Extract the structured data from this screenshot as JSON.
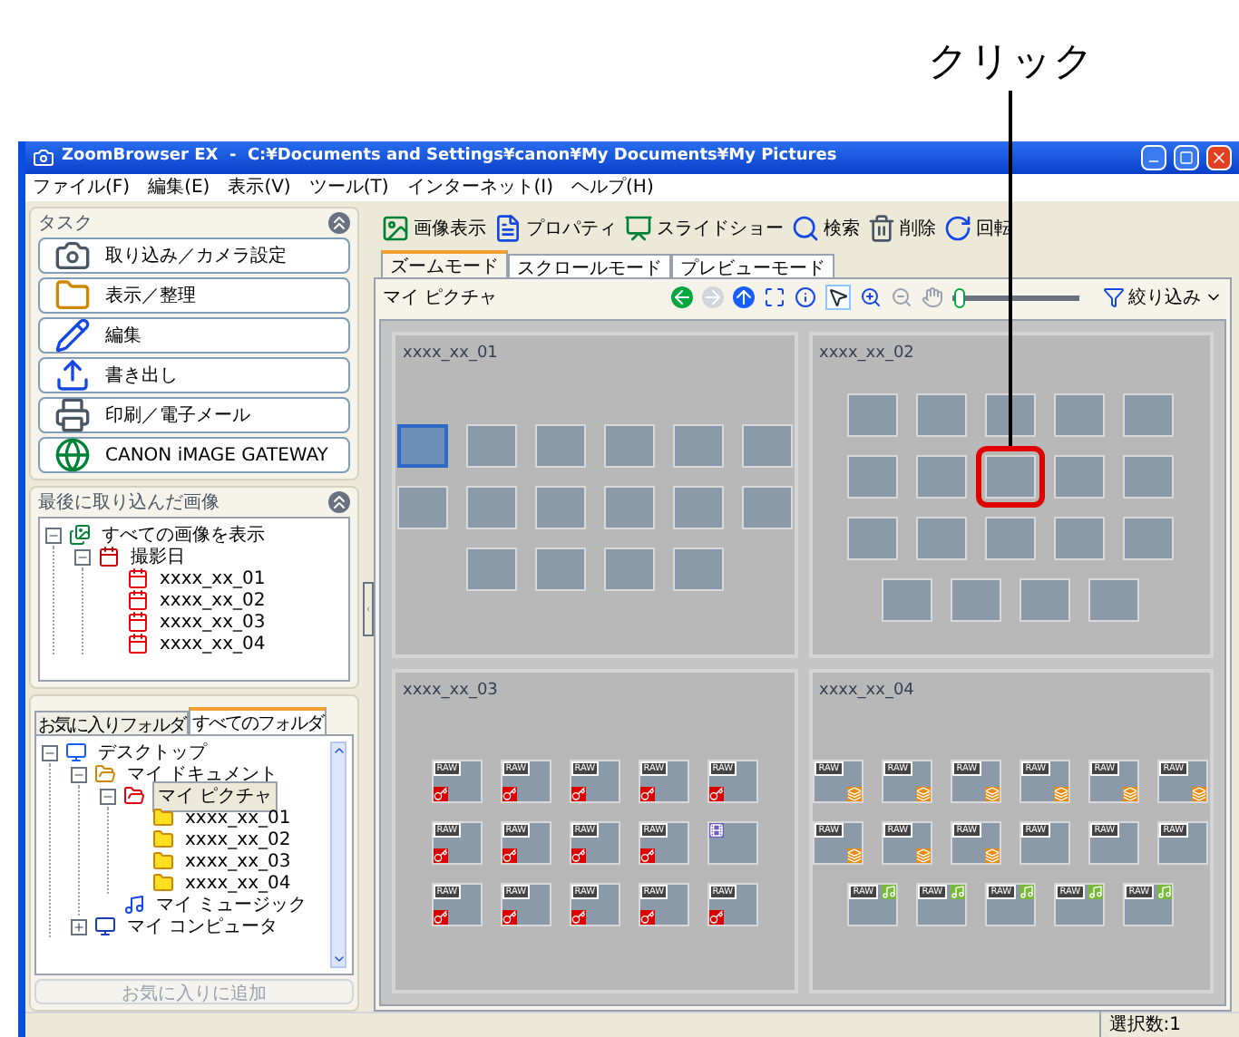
{
  "callout": {
    "label": "クリック"
  },
  "window": {
    "title": "ZoomBrowser EX  -  C:¥Documents and Settings¥canon¥My Documents¥My Pictures"
  },
  "menu": [
    "ファイル(F)",
    "編集(E)",
    "表示(V)",
    "ツール(T)",
    "インターネット(I)",
    "ヘルプ(H)"
  ],
  "tasks": {
    "title": "タスク",
    "items": [
      {
        "label": "取り込み／カメラ設定",
        "kind": "camera"
      },
      {
        "label": "表示／整理",
        "kind": "folder"
      },
      {
        "label": "編集",
        "kind": "edit"
      },
      {
        "label": "書き出し",
        "kind": "export"
      },
      {
        "label": "印刷／電子メール",
        "kind": "print"
      },
      {
        "label": "CANON iMAGE GATEWAY",
        "kind": "globe"
      }
    ]
  },
  "recent": {
    "title": "最後に取り込んだ画像",
    "tree": [
      {
        "label": "すべての画像を表示",
        "kind": "images",
        "expanded": true,
        "children": [
          {
            "label": "撮影日",
            "kind": "calendar",
            "expanded": true,
            "children": [
              {
                "label": "xxxx_xx_01",
                "kind": "date"
              },
              {
                "label": "xxxx_xx_02",
                "kind": "date"
              },
              {
                "label": "xxxx_xx_03",
                "kind": "date"
              },
              {
                "label": "xxxx_xx_04",
                "kind": "date"
              }
            ]
          }
        ]
      }
    ]
  },
  "folders": {
    "tabs": [
      {
        "label": "お気に入りフォルダ",
        "selected": false
      },
      {
        "label": "すべてのフォルダ",
        "selected": true
      }
    ],
    "tree": [
      {
        "label": "デスクトップ",
        "kind": "desktop",
        "expanded": true,
        "selected": false,
        "children": [
          {
            "label": "マイ ドキュメント",
            "kind": "documents",
            "expanded": true,
            "selected": false,
            "children": [
              {
                "label": "マイ ピクチャ",
                "kind": "pictures",
                "expanded": true,
                "selected": true,
                "children": [
                  {
                    "label": "xxxx_xx_01",
                    "kind": "folder",
                    "selected": false
                  },
                  {
                    "label": "xxxx_xx_02",
                    "kind": "folder",
                    "selected": false
                  },
                  {
                    "label": "xxxx_xx_03",
                    "kind": "folder",
                    "selected": false
                  },
                  {
                    "label": "xxxx_xx_04",
                    "kind": "folder",
                    "selected": false
                  }
                ]
              },
              {
                "label": "マイ ミュージック",
                "kind": "music",
                "selected": false
              }
            ]
          },
          {
            "label": "マイ コンピュータ",
            "kind": "computer",
            "expanded": false,
            "selected": false
          }
        ]
      }
    ],
    "add_button": {
      "label": "お気に入りに追加",
      "disabled": true
    }
  },
  "toolbar": [
    {
      "label": "画像表示",
      "kind": "view"
    },
    {
      "label": "プロパティ",
      "kind": "properties"
    },
    {
      "label": "スライドショー",
      "kind": "slideshow"
    },
    {
      "label": "検索",
      "kind": "search"
    },
    {
      "label": "削除",
      "kind": "delete"
    },
    {
      "label": "回転",
      "kind": "rotate"
    }
  ],
  "view_tabs": [
    {
      "label": "ズームモード",
      "selected": true
    },
    {
      "label": "スクロールモード",
      "selected": false
    },
    {
      "label": "プレビューモード",
      "selected": false
    }
  ],
  "location": "マイ ピクチャ",
  "zoom_slider": {
    "level": 0.05
  },
  "filter_button": {
    "label": "絞り込み"
  },
  "groups": [
    {
      "title": "xxxx_xx_01",
      "rows": [
        [
          {
            "selected": true,
            "highlighted": false
          },
          {
            "selected": false,
            "highlighted": false
          },
          {
            "selected": false,
            "highlighted": false
          },
          {
            "selected": false,
            "highlighted": false
          },
          {
            "selected": false,
            "highlighted": false
          },
          {
            "selected": false,
            "highlighted": false
          }
        ],
        [
          {
            "selected": false,
            "highlighted": false
          },
          {
            "selected": false,
            "highlighted": false
          },
          {
            "selected": false,
            "highlighted": false
          },
          {
            "selected": false,
            "highlighted": false
          },
          {
            "selected": false,
            "highlighted": false
          },
          {
            "selected": false,
            "highlighted": false
          }
        ],
        [
          {
            "selected": false,
            "highlighted": false
          },
          {
            "selected": false,
            "highlighted": false
          },
          {
            "selected": false,
            "highlighted": false
          },
          {
            "selected": false,
            "highlighted": false
          }
        ]
      ]
    },
    {
      "title": "xxxx_xx_02",
      "rows": [
        [
          {
            "selected": false,
            "highlighted": false
          },
          {
            "selected": false,
            "highlighted": false
          },
          {
            "selected": false,
            "highlighted": false
          },
          {
            "selected": false,
            "highlighted": false
          },
          {
            "selected": false,
            "highlighted": false
          }
        ],
        [
          {
            "selected": false,
            "highlighted": false
          },
          {
            "selected": false,
            "highlighted": false
          },
          {
            "selected": false,
            "highlighted": true
          },
          {
            "selected": false,
            "highlighted": false
          },
          {
            "selected": false,
            "highlighted": false
          }
        ],
        [
          {
            "selected": false,
            "highlighted": false
          },
          {
            "selected": false,
            "highlighted": false
          },
          {
            "selected": false,
            "highlighted": false
          },
          {
            "selected": false,
            "highlighted": false
          },
          {
            "selected": false,
            "highlighted": false
          }
        ],
        [
          {
            "selected": false,
            "highlighted": false
          },
          {
            "selected": false,
            "highlighted": false
          },
          {
            "selected": false,
            "highlighted": false
          },
          {
            "selected": false,
            "highlighted": false
          }
        ]
      ]
    },
    {
      "title": "xxxx_xx_03",
      "rows": [
        [
          {
            "selected": false,
            "highlighted": false,
            "raw": "RAW",
            "protected": true,
            "movie": false
          },
          {
            "selected": false,
            "highlighted": false,
            "raw": "RAW",
            "protected": true,
            "movie": false
          },
          {
            "selected": false,
            "highlighted": false,
            "raw": "RAW",
            "protected": true,
            "movie": false
          },
          {
            "selected": false,
            "highlighted": false,
            "raw": "RAW",
            "protected": true,
            "movie": false
          },
          {
            "selected": false,
            "highlighted": false,
            "raw": "RAW",
            "protected": true,
            "movie": false
          }
        ],
        [
          {
            "selected": false,
            "highlighted": false,
            "raw": "RAW",
            "protected": true,
            "movie": false
          },
          {
            "selected": false,
            "highlighted": false,
            "raw": "RAW",
            "protected": true,
            "movie": false
          },
          {
            "selected": false,
            "highlighted": false,
            "raw": "RAW",
            "protected": true,
            "movie": false
          },
          {
            "selected": false,
            "highlighted": false,
            "raw": "RAW",
            "protected": true,
            "movie": false
          },
          {
            "selected": false,
            "highlighted": false,
            "protected": false,
            "movie": true
          }
        ],
        [
          {
            "selected": false,
            "highlighted": false,
            "raw": "RAW",
            "protected": true,
            "movie": false
          },
          {
            "selected": false,
            "highlighted": false,
            "raw": "RAW",
            "protected": true,
            "movie": false
          },
          {
            "selected": false,
            "highlighted": false,
            "raw": "RAW",
            "protected": true,
            "movie": false
          },
          {
            "selected": false,
            "highlighted": false,
            "raw": "RAW",
            "protected": true,
            "movie": false
          },
          {
            "selected": false,
            "highlighted": false,
            "raw": "RAW",
            "protected": true,
            "movie": false
          }
        ]
      ]
    },
    {
      "title": "xxxx_xx_04",
      "rows": [
        [
          {
            "selected": false,
            "highlighted": false,
            "raw": "RAW",
            "stitch": true,
            "sound": false
          },
          {
            "selected": false,
            "highlighted": false,
            "raw": "RAW",
            "stitch": true,
            "sound": false
          },
          {
            "selected": false,
            "highlighted": false,
            "raw": "RAW",
            "stitch": true,
            "sound": false
          },
          {
            "selected": false,
            "highlighted": false,
            "raw": "RAW",
            "stitch": true,
            "sound": false
          },
          {
            "selected": false,
            "highlighted": false,
            "raw": "RAW",
            "stitch": true,
            "sound": false
          },
          {
            "selected": false,
            "highlighted": false,
            "raw": "RAW",
            "stitch": true,
            "sound": false
          }
        ],
        [
          {
            "selected": false,
            "highlighted": false,
            "raw": "RAW",
            "stitch": true,
            "sound": false
          },
          {
            "selected": false,
            "highlighted": false,
            "raw": "RAW",
            "stitch": true,
            "sound": false
          },
          {
            "selected": false,
            "highlighted": false,
            "raw": "RAW",
            "stitch": true,
            "sound": false
          },
          {
            "selected": false,
            "highlighted": false,
            "raw": "RAW",
            "stitch": false,
            "sound": false
          },
          {
            "selected": false,
            "highlighted": false,
            "raw": "RAW",
            "stitch": false,
            "sound": false
          },
          {
            "selected": false,
            "highlighted": false,
            "raw": "RAW",
            "stitch": false,
            "sound": false
          }
        ],
        [
          {
            "selected": false,
            "highlighted": false,
            "raw": "RAW",
            "stitch": false,
            "sound": true
          },
          {
            "selected": false,
            "highlighted": false,
            "raw": "RAW",
            "stitch": false,
            "sound": true
          },
          {
            "selected": false,
            "highlighted": false,
            "raw": "RAW",
            "stitch": false,
            "sound": true
          },
          {
            "selected": false,
            "highlighted": false,
            "raw": "RAW",
            "stitch": false,
            "sound": true
          },
          {
            "selected": false,
            "highlighted": false,
            "raw": "RAW",
            "stitch": false,
            "sound": true
          }
        ]
      ]
    }
  ],
  "status": "選択数:1"
}
